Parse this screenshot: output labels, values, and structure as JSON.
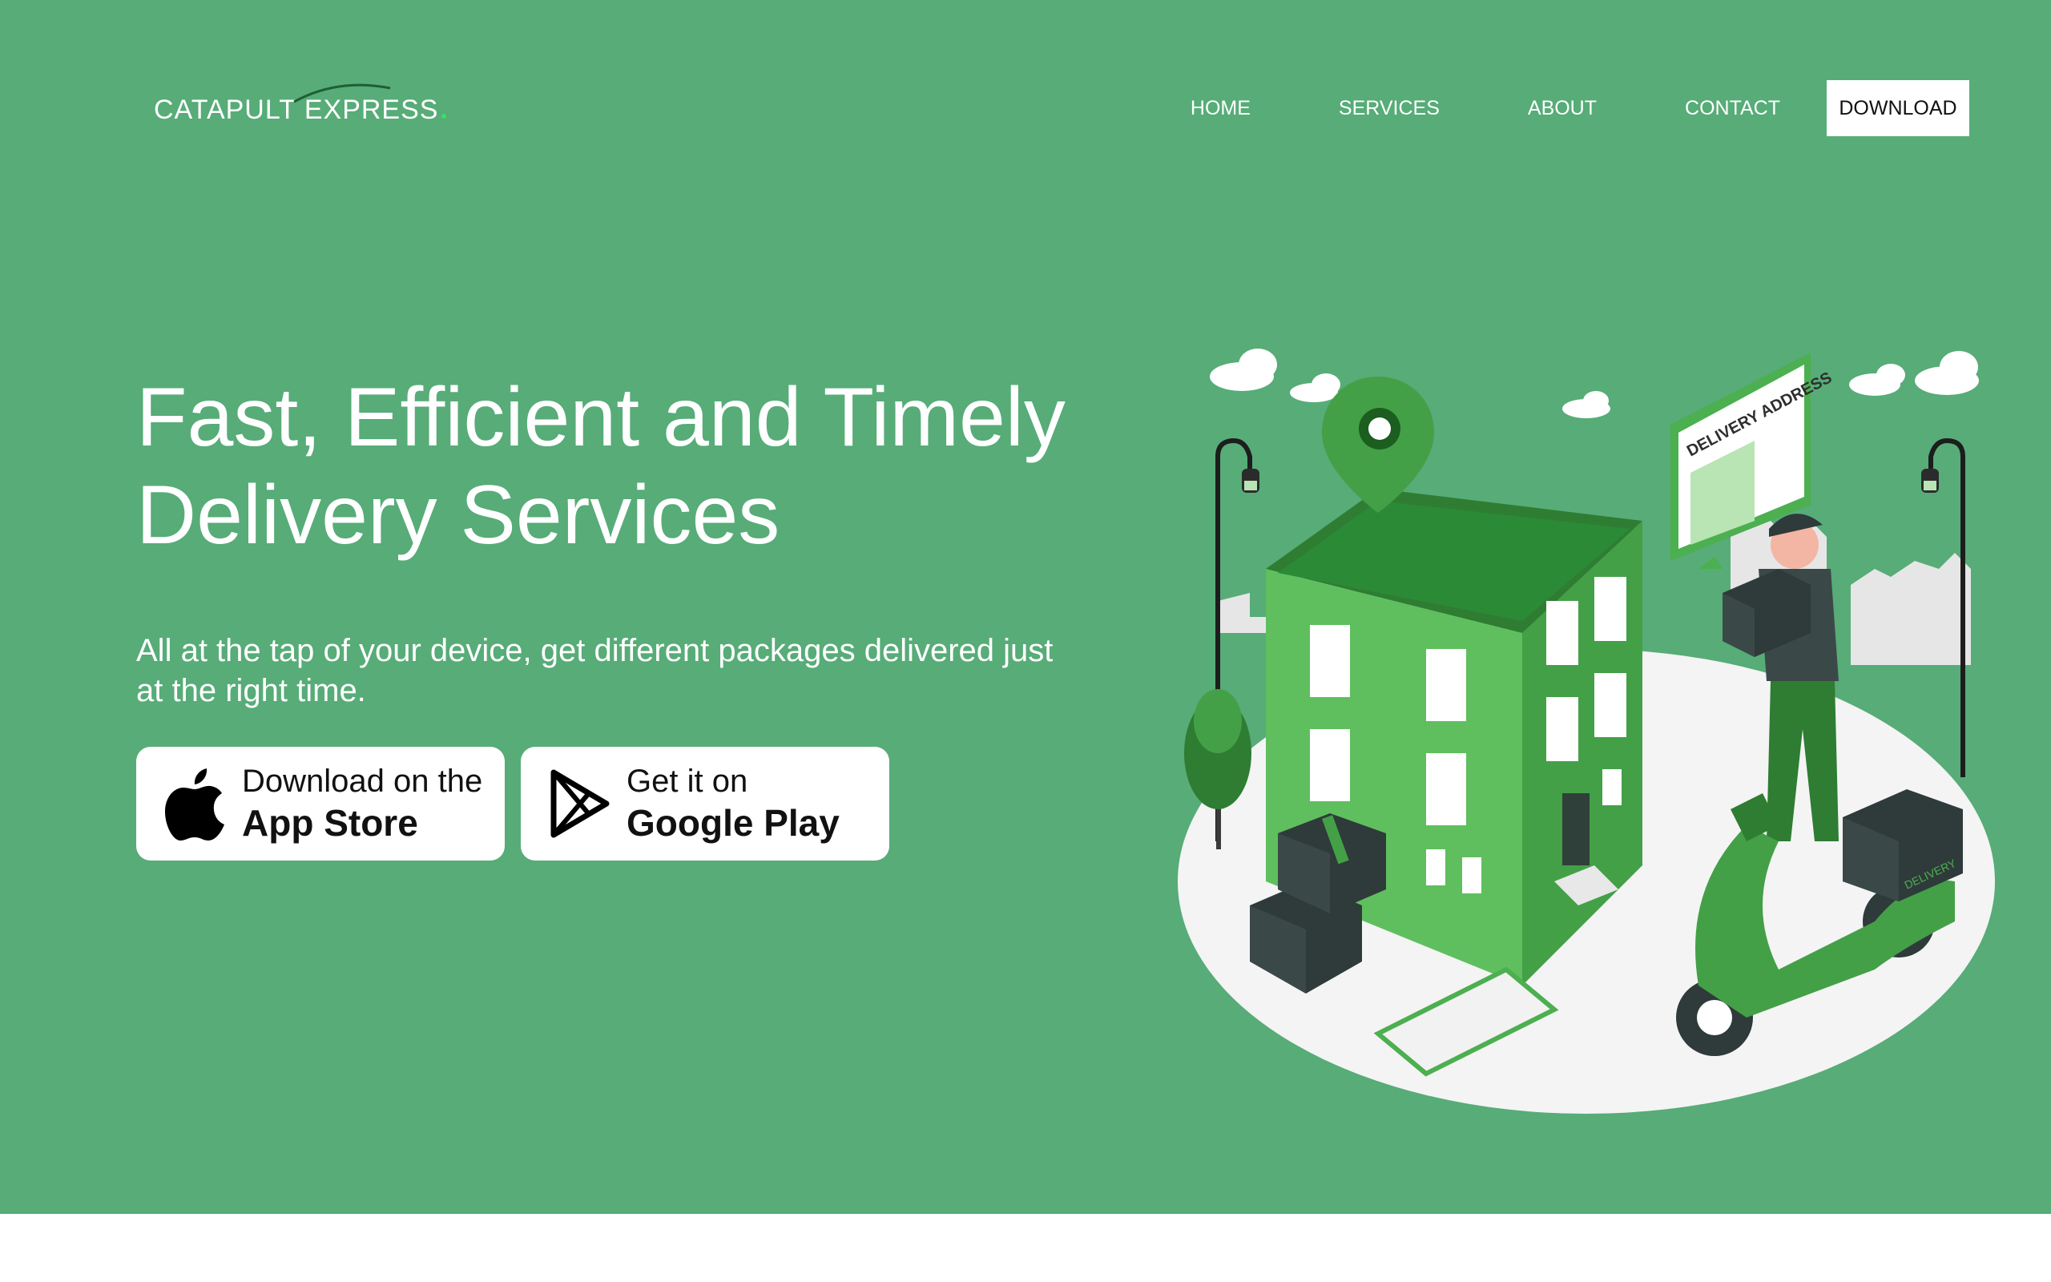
{
  "header": {
    "logo_text": "CATAPULT EXPRESS",
    "nav": [
      "HOME",
      "SERVICES",
      "ABOUT",
      "CONTACT"
    ],
    "download_label": "DOWNLOAD"
  },
  "hero": {
    "headline_line1": "Fast, Efficient and Timely",
    "headline_line2": "Delivery Services",
    "subtext": "All at the tap of your device, get different packages delivered just at the right time.",
    "app_store": {
      "small": "Download on the",
      "big": "App Store"
    },
    "google_play": {
      "small": "Get it on",
      "big": "Google Play"
    }
  },
  "illustration": {
    "sign_text": "DELIVERY ADDRESS",
    "scooter_box_text": "DELIVERY"
  },
  "colors": {
    "hero_bg": "#57ac78",
    "brand_green": "#4caf50",
    "dark_green": "#2e7d32"
  }
}
